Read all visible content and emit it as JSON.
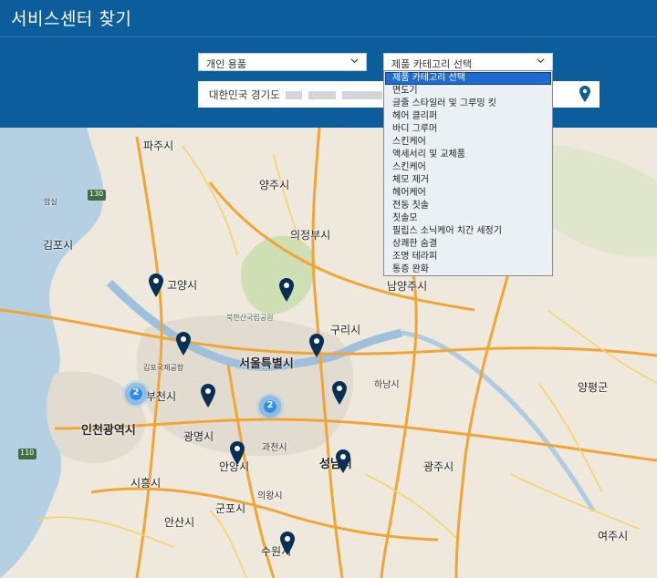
{
  "header": {
    "title": "서비스센터 찾기"
  },
  "filters": {
    "product_type": "개인 용품",
    "category": "제품 카테고리 선택",
    "location": "대한민국 경기도"
  },
  "dropdown": {
    "options": [
      "제품 카테고리 선택",
      "면도기",
      "글줄 스타일러 및 그루밍 킷",
      "헤어 클리퍼",
      "바디 그루머",
      "스킨케어",
      "액세서리 및 교체품",
      "스킨케어",
      "체모 제거",
      "헤어케어",
      "전동 칫솔",
      "칫솔모",
      "필립스 소닉케어 치간 세정기",
      "상쾌한 숨결",
      "조명 테라피",
      "통증 완화"
    ]
  },
  "map": {
    "labels": {
      "paju": "파주시",
      "yangju": "양주시",
      "uijeongbu": "의정부시",
      "gimpo": "김포시",
      "goyang": "고양시",
      "bukhansan": "북한산국립공원",
      "namyangju": "남양주시",
      "guri": "구리시",
      "gimpo_airport": "김포국제공항",
      "seoul": "서울특별시",
      "hanam": "하남시",
      "yangpyeong": "양평군",
      "bucheon": "부천시",
      "incheon": "인천광역시",
      "gwangmyeong": "광명시",
      "gwacheon": "과천시",
      "anyang": "안양시",
      "seongnam": "성남시",
      "gwangju": "광주시",
      "siheung": "시흥시",
      "gunpo": "군포시",
      "uiwang": "의왕시",
      "ansan": "안산시",
      "suwon": "수원시",
      "yeoju": "여주시",
      "amsil": "암실"
    },
    "road_badges": {
      "r130": "130",
      "r110": "110"
    },
    "clusters": [
      "2",
      "2"
    ]
  }
}
